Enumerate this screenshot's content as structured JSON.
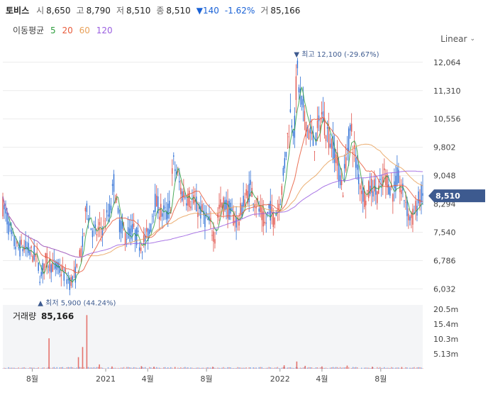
{
  "stock": {
    "name": "토비스",
    "open_label": "시",
    "open": "8,650",
    "high_label": "고",
    "high": "8,790",
    "low_label": "저",
    "low": "8,510",
    "close_label": "종",
    "close": "8,510",
    "change": "▼140",
    "change_pct": "-1.62%",
    "volume_label": "거",
    "volume": "85,166"
  },
  "moving_avg": {
    "label": "이동평균",
    "periods": [
      {
        "period": "5",
        "color": "#2e9e3e"
      },
      {
        "period": "20",
        "color": "#e85b3b"
      },
      {
        "period": "60",
        "color": "#e8a15a"
      },
      {
        "period": "120",
        "color": "#9a5ee0"
      }
    ]
  },
  "scale_mode": "Linear",
  "volume_panel": {
    "title": "거래량",
    "value": "85,166"
  },
  "colors": {
    "up": "#e0524a",
    "down": "#2e6fd6",
    "badge": "#3d5a8f",
    "ma5": "#2e9e3e",
    "ma20": "#e85b3b",
    "ma60": "#e8a15a",
    "ma120": "#9a5ee0"
  },
  "chart_data": {
    "type": "candlestick",
    "y_ticks": [
      "12,064",
      "11,310",
      "10,556",
      "9,802",
      "9,048",
      "8,294",
      "7,540",
      "6,786",
      "6,032"
    ],
    "y_tick_values": [
      12064,
      11310,
      10556,
      9802,
      9048,
      8294,
      7540,
      6786,
      6032
    ],
    "ylim": [
      5700,
      12400
    ],
    "x_ticks": [
      "8월",
      "2021",
      "4월",
      "8월",
      "2022",
      "4월",
      "8월"
    ],
    "x_tick_positions": [
      0.07,
      0.245,
      0.345,
      0.485,
      0.66,
      0.76,
      0.9
    ],
    "last_price": 8510,
    "last_price_label": "8,510",
    "high_marker": {
      "label": "▼ 최고 12,100 (-29.67%)",
      "value": 12100,
      "position": 0.7
    },
    "low_marker": {
      "label": "▲ 최저 5,900 (44.24%)",
      "value": 5900,
      "position": 0.09
    },
    "price_path": [
      [
        0.0,
        8250
      ],
      [
        0.01,
        7900
      ],
      [
        0.02,
        7400
      ],
      [
        0.035,
        7100
      ],
      [
        0.05,
        7150
      ],
      [
        0.065,
        7000
      ],
      [
        0.08,
        6900
      ],
      [
        0.09,
        6300
      ],
      [
        0.1,
        6800
      ],
      [
        0.12,
        6650
      ],
      [
        0.14,
        6500
      ],
      [
        0.16,
        6200
      ],
      [
        0.175,
        6450
      ],
      [
        0.19,
        7200
      ],
      [
        0.2,
        8300
      ],
      [
        0.21,
        7700
      ],
      [
        0.22,
        7500
      ],
      [
        0.24,
        7700
      ],
      [
        0.255,
        8100
      ],
      [
        0.265,
        8900
      ],
      [
        0.275,
        7900
      ],
      [
        0.29,
        7450
      ],
      [
        0.31,
        7600
      ],
      [
        0.33,
        7200
      ],
      [
        0.35,
        7550
      ],
      [
        0.36,
        8400
      ],
      [
        0.375,
        8100
      ],
      [
        0.39,
        8000
      ],
      [
        0.4,
        8300
      ],
      [
        0.405,
        9400
      ],
      [
        0.415,
        9100
      ],
      [
        0.425,
        8600
      ],
      [
        0.44,
        8500
      ],
      [
        0.455,
        8300
      ],
      [
        0.47,
        8100
      ],
      [
        0.49,
        7800
      ],
      [
        0.505,
        7450
      ],
      [
        0.515,
        8200
      ],
      [
        0.53,
        8300
      ],
      [
        0.545,
        8000
      ],
      [
        0.56,
        7800
      ],
      [
        0.575,
        8400
      ],
      [
        0.59,
        8700
      ],
      [
        0.605,
        8300
      ],
      [
        0.625,
        7700
      ],
      [
        0.635,
        8200
      ],
      [
        0.645,
        7900
      ],
      [
        0.655,
        8200
      ],
      [
        0.665,
        8700
      ],
      [
        0.675,
        9800
      ],
      [
        0.685,
        10700
      ],
      [
        0.695,
        10300
      ],
      [
        0.7,
        11900
      ],
      [
        0.71,
        11000
      ],
      [
        0.72,
        10500
      ],
      [
        0.73,
        10200
      ],
      [
        0.74,
        9900
      ],
      [
        0.75,
        10200
      ],
      [
        0.76,
        10700
      ],
      [
        0.77,
        10300
      ],
      [
        0.78,
        10000
      ],
      [
        0.79,
        9700
      ],
      [
        0.8,
        9200
      ],
      [
        0.81,
        8700
      ],
      [
        0.82,
        9800
      ],
      [
        0.83,
        10300
      ],
      [
        0.84,
        9400
      ],
      [
        0.85,
        8900
      ],
      [
        0.86,
        8500
      ],
      [
        0.87,
        8600
      ],
      [
        0.88,
        8800
      ],
      [
        0.89,
        8600
      ],
      [
        0.9,
        8700
      ],
      [
        0.91,
        9100
      ],
      [
        0.92,
        8800
      ],
      [
        0.93,
        8600
      ],
      [
        0.94,
        9000
      ],
      [
        0.95,
        8600
      ],
      [
        0.96,
        8400
      ],
      [
        0.965,
        8000
      ],
      [
        0.975,
        7900
      ],
      [
        0.985,
        8200
      ],
      [
        0.995,
        8510
      ]
    ],
    "volume_ticks": [
      "20.5m",
      "15.4m",
      "10.3m",
      "5.13m"
    ],
    "volume_tick_values": [
      20500000,
      15400000,
      10300000,
      5130000
    ],
    "volume_spikes": [
      [
        0.11,
        10500000
      ],
      [
        0.18,
        4000000
      ],
      [
        0.19,
        7500000
      ],
      [
        0.2,
        18500000
      ],
      [
        0.23,
        1500000
      ],
      [
        0.26,
        800000
      ],
      [
        0.33,
        900000
      ],
      [
        0.36,
        700000
      ],
      [
        0.41,
        600000
      ],
      [
        0.5,
        700000
      ],
      [
        0.67,
        1200000
      ],
      [
        0.7,
        2500000
      ],
      [
        0.72,
        1000000
      ],
      [
        0.76,
        800000
      ],
      [
        0.82,
        1100000
      ],
      [
        0.88,
        700000
      ],
      [
        0.95,
        600000
      ]
    ]
  }
}
